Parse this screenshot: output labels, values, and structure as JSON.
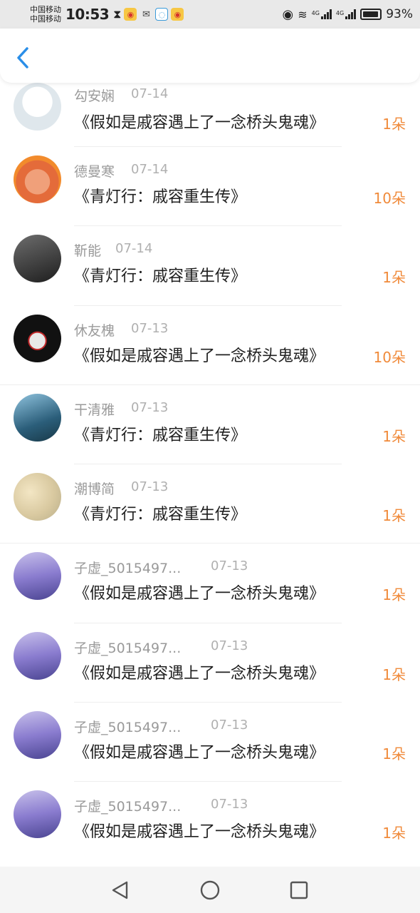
{
  "status_bar": {
    "carrier_1": "中国移动",
    "carrier_2": "中国移动",
    "time": "10:53",
    "network_1": "4G",
    "network_2": "4G",
    "battery": "93%",
    "battery_level": 0.93
  },
  "header": {
    "back_icon": "chevron-left-icon"
  },
  "colors": {
    "accent": "#2a8ee8",
    "count": "#f08a3a",
    "name": "#9a9a9a",
    "title": "#1f1f1f"
  },
  "items": [
    {
      "user": "勾安娴",
      "date": "07-14",
      "title": "《假如是戚容遇上了一念桥头鬼魂》",
      "count": "1朵"
    },
    {
      "user": "德曼寒",
      "date": "07-14",
      "title": "《青灯行：戚容重生传》",
      "count": "10朵"
    },
    {
      "user": "靳能",
      "date": "07-14",
      "title": "《青灯行：戚容重生传》",
      "count": "1朵"
    },
    {
      "user": "休友槐",
      "date": "07-13",
      "title": "《假如是戚容遇上了一念桥头鬼魂》",
      "count": "10朵"
    },
    {
      "user": "干清雅",
      "date": "07-13",
      "title": "《青灯行：戚容重生传》",
      "count": "1朵"
    },
    {
      "user": "潮博简",
      "date": "07-13",
      "title": "《青灯行：戚容重生传》",
      "count": "1朵"
    },
    {
      "user": "子虚_5015497...",
      "date": "07-13",
      "title": "《假如是戚容遇上了一念桥头鬼魂》",
      "count": "1朵"
    },
    {
      "user": "子虚_5015497...",
      "date": "07-13",
      "title": "《假如是戚容遇上了一念桥头鬼魂》",
      "count": "1朵"
    },
    {
      "user": "子虚_5015497...",
      "date": "07-13",
      "title": "《假如是戚容遇上了一念桥头鬼魂》",
      "count": "1朵"
    },
    {
      "user": "子虚_5015497...",
      "date": "07-13",
      "title": "《假如是戚容遇上了一念桥头鬼魂》",
      "count": "1朵"
    }
  ],
  "nav_bar": {
    "back": "back-triangle-icon",
    "home": "home-circle-icon",
    "recents": "recents-square-icon"
  }
}
